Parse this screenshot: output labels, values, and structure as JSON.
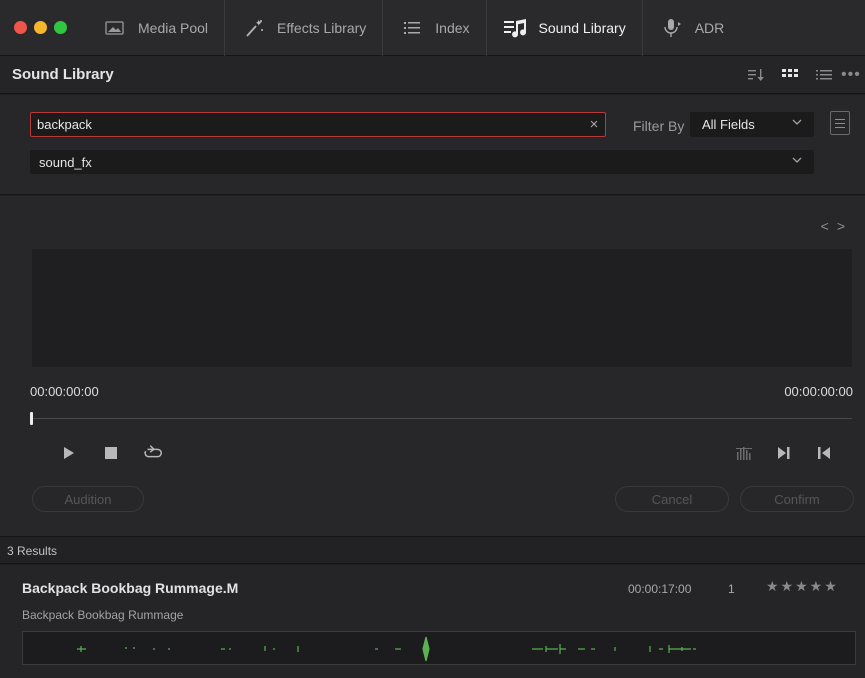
{
  "tabs": [
    {
      "label": "Media Pool",
      "icon": "media-pool-icon",
      "active": false
    },
    {
      "label": "Effects Library",
      "icon": "effects-wand-icon",
      "active": false
    },
    {
      "label": "Index",
      "icon": "index-list-icon",
      "active": false
    },
    {
      "label": "Sound Library",
      "icon": "sound-library-icon",
      "active": true
    },
    {
      "label": "ADR",
      "icon": "microphone-icon",
      "active": false
    }
  ],
  "header": {
    "title": "Sound Library"
  },
  "search": {
    "value": "backpack",
    "clear_glyph": "×"
  },
  "filter": {
    "label": "Filter By",
    "selected": "All Fields"
  },
  "database": {
    "selected": "sound_fx"
  },
  "player": {
    "timecode_start": "00:00:00:00",
    "timecode_end": "00:00:00:00",
    "position": 0,
    "audition_label": "Audition",
    "cancel_label": "Cancel",
    "confirm_label": "Confirm"
  },
  "results": {
    "count_label": "3 Results",
    "items": [
      {
        "title": "Backpack Bookbag Rummage.M",
        "subtitle": "Backpack Bookbag Rummage",
        "duration": "00:00:17:00",
        "channels": "1",
        "rating": "★★★★★"
      }
    ]
  },
  "colors": {
    "accent_red": "#b8393a",
    "waveform_green": "#5ab352",
    "light_red": "#f0554b",
    "light_yellow": "#f5b82a",
    "light_green": "#30c640"
  }
}
